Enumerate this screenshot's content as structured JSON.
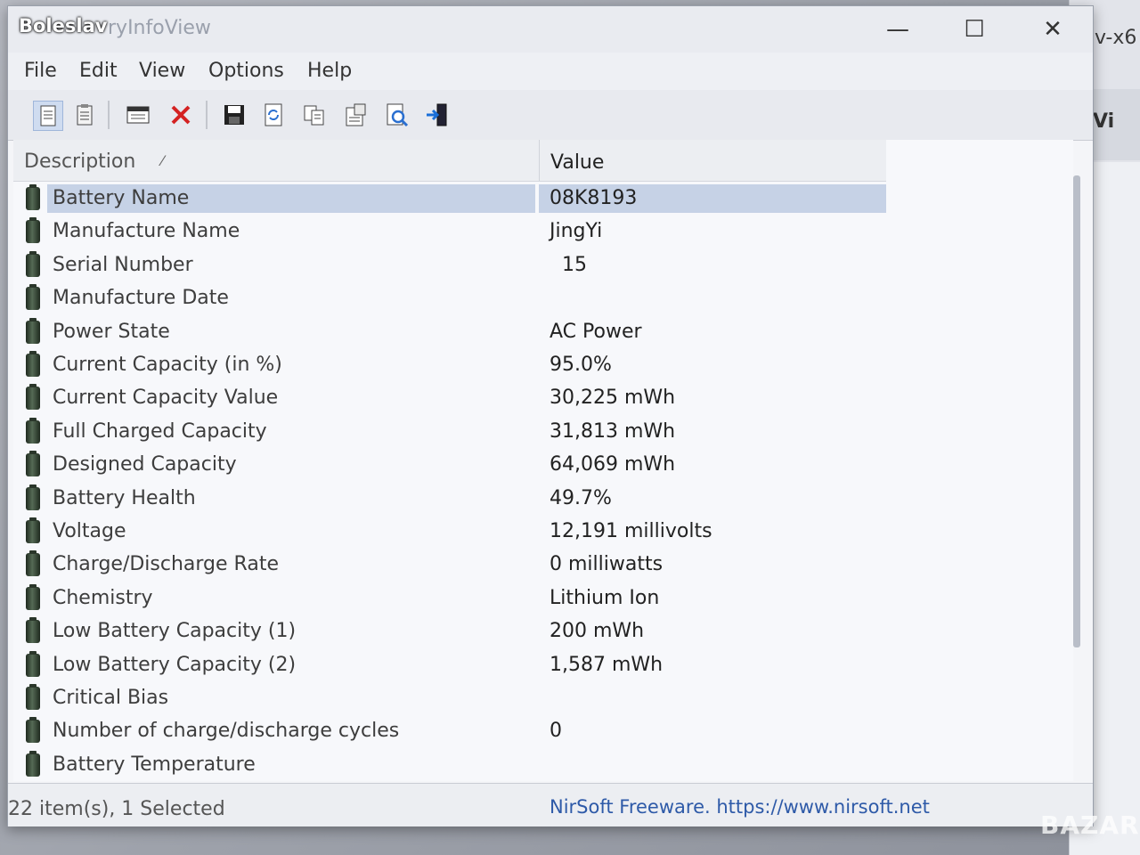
{
  "window": {
    "user": "Boleslav",
    "title_partial": "ryInfoView",
    "controls": {
      "minimize": "—",
      "maximize": "☐",
      "close": "✕"
    }
  },
  "background_window": {
    "title_partial": "v-x6",
    "tab_label": "Vi"
  },
  "menu": [
    "File",
    "Edit",
    "View",
    "Options",
    "Help"
  ],
  "columns": {
    "description": "Description",
    "value": "Value"
  },
  "rows": [
    {
      "description": "Battery Name",
      "value": "08K8193",
      "selected": true
    },
    {
      "description": "Manufacture Name",
      "value": "JingYi"
    },
    {
      "description": "Serial Number",
      "value": "  15"
    },
    {
      "description": "Manufacture Date",
      "value": ""
    },
    {
      "description": "Power State",
      "value": "AC Power"
    },
    {
      "description": "Current Capacity (in %)",
      "value": "95.0%"
    },
    {
      "description": "Current Capacity Value",
      "value": "30,225 mWh"
    },
    {
      "description": "Full Charged Capacity",
      "value": "31,813 mWh"
    },
    {
      "description": "Designed Capacity",
      "value": "64,069 mWh"
    },
    {
      "description": "Battery Health",
      "value": "49.7%"
    },
    {
      "description": "Voltage",
      "value": "12,191 millivolts"
    },
    {
      "description": "Charge/Discharge Rate",
      "value": "0 milliwatts"
    },
    {
      "description": "Chemistry",
      "value": "Lithium Ion"
    },
    {
      "description": "Low Battery Capacity (1)",
      "value": "200 mWh"
    },
    {
      "description": "Low Battery Capacity (2)",
      "value": "1,587 mWh"
    },
    {
      "description": "Critical Bias",
      "value": ""
    },
    {
      "description": "Number of charge/discharge cycles",
      "value": "0"
    },
    {
      "description": "Battery Temperature",
      "value": ""
    }
  ],
  "status": {
    "count": "22 item(s), 1 Selected",
    "link": "NirSoft Freeware. https://www.nirsoft.net"
  },
  "watermark": "BAZAR"
}
